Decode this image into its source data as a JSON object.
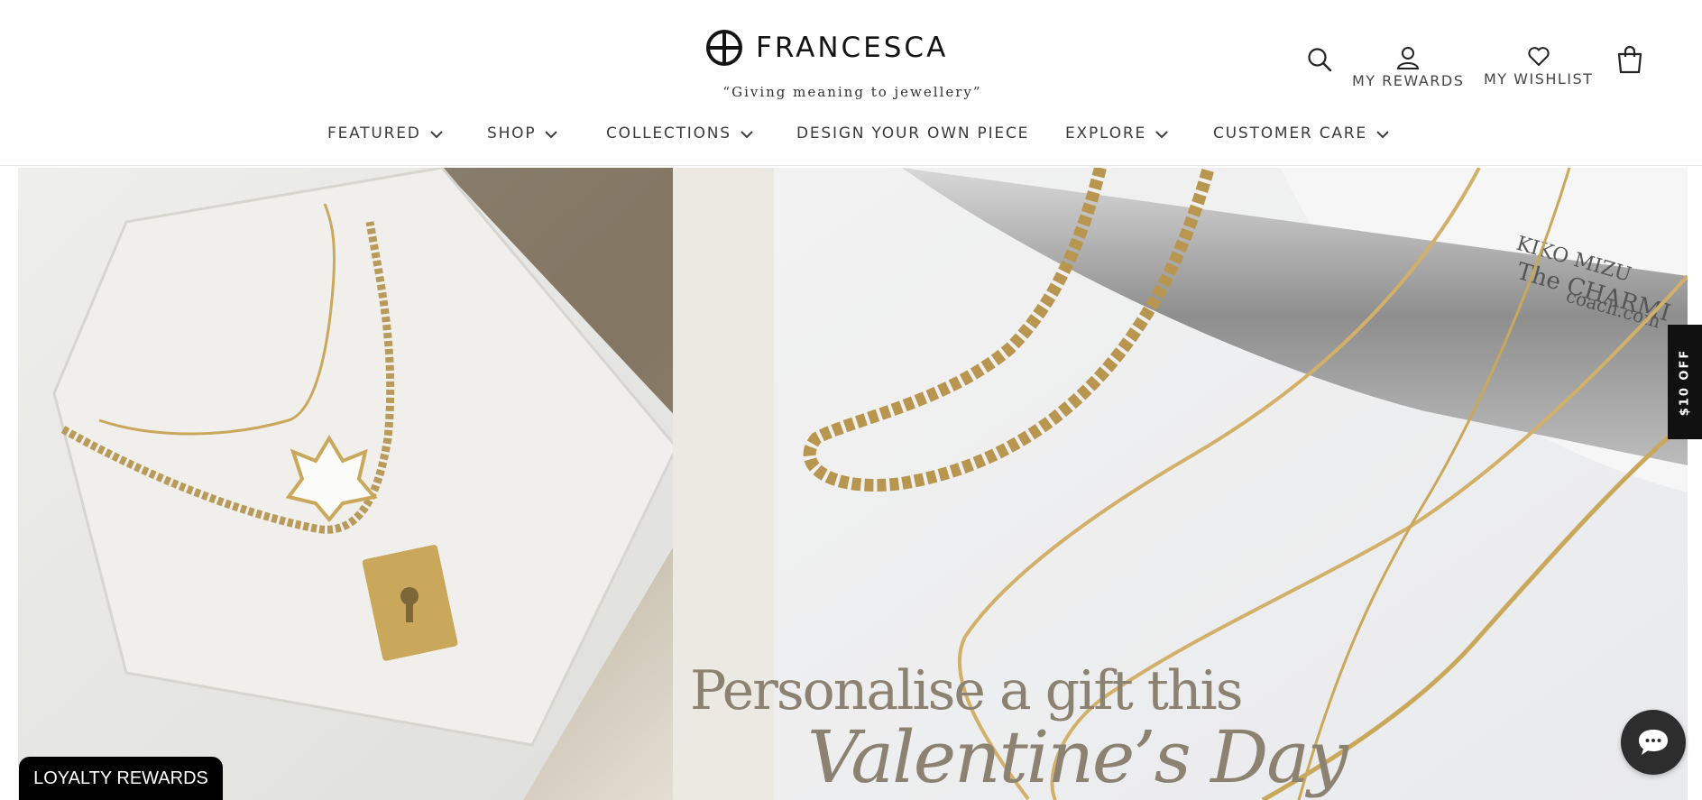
{
  "brand": {
    "name": "FRANCESCA",
    "tagline": "“Giving meaning to jewellery”"
  },
  "header": {
    "search_icon": "search-icon",
    "rewards_label": "MY REWARDS",
    "wishlist_label": "MY WISHLIST",
    "cart_icon": "shopping-bag-icon"
  },
  "nav": {
    "items": [
      {
        "label": "FEATURED",
        "has_dropdown": true
      },
      {
        "label": "SHOP",
        "has_dropdown": true
      },
      {
        "label": "COLLECTIONS",
        "has_dropdown": true
      },
      {
        "label": "DESIGN YOUR OWN PIECE",
        "has_dropdown": false
      },
      {
        "label": "EXPLORE",
        "has_dropdown": true
      },
      {
        "label": "CUSTOMER CARE",
        "has_dropdown": true
      }
    ]
  },
  "hero": {
    "line1": "Personalise a gift this",
    "line2": "Valentine’s Day",
    "image_text": [
      "KIKO MIZU",
      "The CHARMI",
      "coach.com"
    ]
  },
  "offer_tab": {
    "label": "$10 OFF"
  },
  "loyalty_button": {
    "label": "LOYALTY REWARDS"
  },
  "chat_button": {
    "icon": "chat-bubble-icon"
  },
  "colors": {
    "text": "#3a3a3a",
    "hero_text": "#8c8272",
    "gold": "#c9a85c",
    "dark": "#111111"
  }
}
